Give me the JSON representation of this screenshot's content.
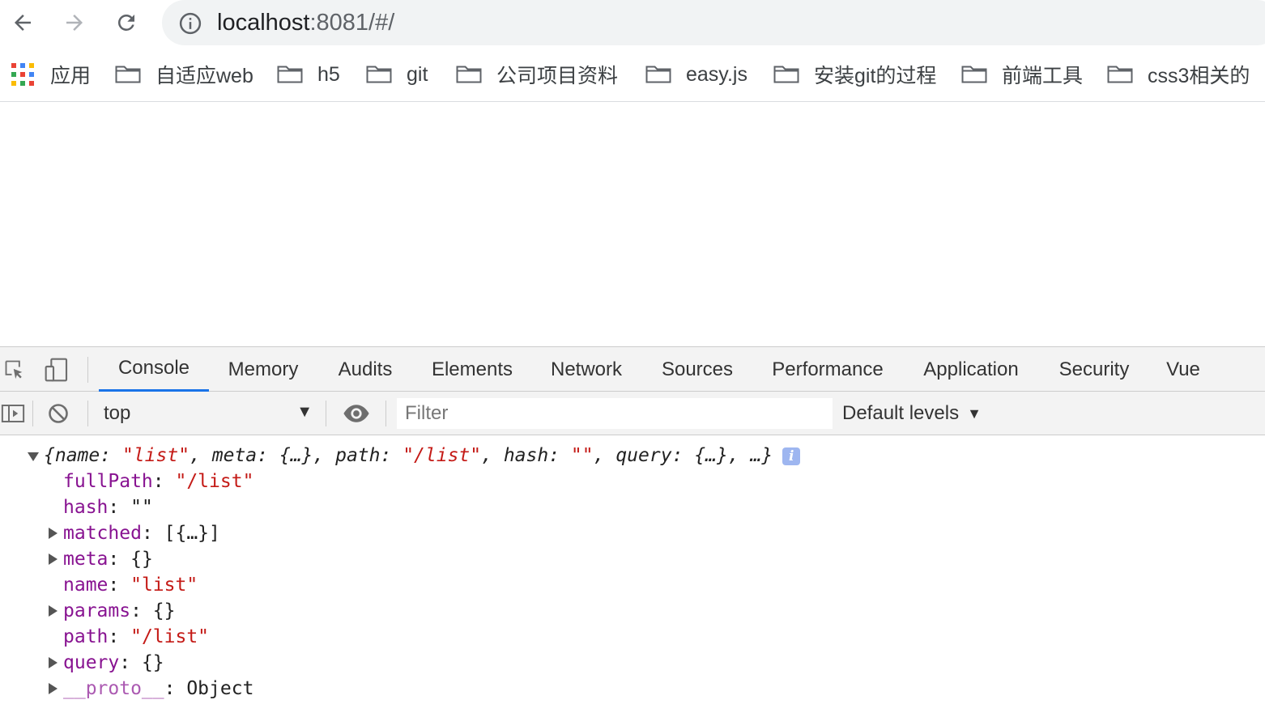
{
  "browser": {
    "url_host": "localhost",
    "url_path": ":8081/#/"
  },
  "bookmarks": {
    "apps_label": "应用",
    "items": [
      {
        "label": "自适应web"
      },
      {
        "label": "h5"
      },
      {
        "label": "git"
      },
      {
        "label": "公司项目资料"
      },
      {
        "label": "easy.js"
      },
      {
        "label": "安装git的过程"
      },
      {
        "label": "前端工具"
      },
      {
        "label": "css3相关的"
      }
    ],
    "apps_colors": [
      "#ea4335",
      "#4285f4",
      "#fbbc05",
      "#34a853",
      "#ea4335",
      "#4285f4",
      "#fbbc05",
      "#34a853",
      "#ea4335"
    ]
  },
  "devtools": {
    "tabs": [
      {
        "label": "Console",
        "active": true
      },
      {
        "label": "Memory"
      },
      {
        "label": "Audits"
      },
      {
        "label": "Elements"
      },
      {
        "label": "Network"
      },
      {
        "label": "Sources"
      },
      {
        "label": "Performance"
      },
      {
        "label": "Application"
      },
      {
        "label": "Security"
      },
      {
        "label": "Vue"
      }
    ],
    "context": "top",
    "filter_placeholder": "Filter",
    "levels_label": "Default levels",
    "accent": "#1a73e8"
  },
  "console": {
    "summary": {
      "open": "{",
      "k1": "name",
      "v1": "\"list\"",
      "k2": "meta",
      "v2": "{…}",
      "k3": "path",
      "v3": "\"/list\"",
      "k4": "hash",
      "v4": "\"\"",
      "k5": "query",
      "v5": "{…}",
      "tail": ", …}",
      "info": "i"
    },
    "props": [
      {
        "key": "fullPath",
        "value": "\"/list\"",
        "kind": "string",
        "expandable": false
      },
      {
        "key": "hash",
        "value": "\"\"",
        "kind": "plain",
        "expandable": false
      },
      {
        "key": "matched",
        "value": "[{…}]",
        "kind": "plain",
        "expandable": true
      },
      {
        "key": "meta",
        "value": "{}",
        "kind": "plain",
        "expandable": true
      },
      {
        "key": "name",
        "value": "\"list\"",
        "kind": "string",
        "expandable": false
      },
      {
        "key": "params",
        "value": "{}",
        "kind": "plain",
        "expandable": true
      },
      {
        "key": "path",
        "value": "\"/list\"",
        "kind": "string",
        "expandable": false
      },
      {
        "key": "query",
        "value": "{}",
        "kind": "plain",
        "expandable": true
      },
      {
        "key": "__proto__",
        "value": "Object",
        "kind": "plain",
        "expandable": true
      }
    ]
  }
}
